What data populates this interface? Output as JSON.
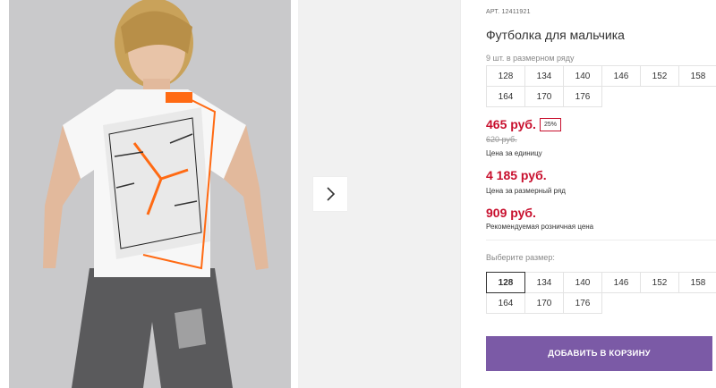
{
  "product": {
    "sku_prefix": "АРТ.",
    "sku": "12411921",
    "title": "Футболка для мальчика",
    "size_run_label": "9 шт. в размерном ряду",
    "size_run": [
      "128",
      "134",
      "140",
      "146",
      "152",
      "158",
      "164",
      "170",
      "176"
    ]
  },
  "pricing": {
    "unit_price": "465 руб.",
    "discount_badge": "25%",
    "old_price": "620 руб.",
    "unit_caption": "Цена за единицу",
    "run_price": "4 185 руб.",
    "run_caption": "Цена за размерный ряд",
    "retail_price": "909 руб.",
    "retail_caption": "Рекомендуемая розничная цена"
  },
  "size_select": {
    "label": "Выберите размер:",
    "options": [
      "128",
      "134",
      "140",
      "146",
      "152",
      "158",
      "164",
      "170",
      "176"
    ],
    "selected": "128"
  },
  "actions": {
    "add_to_cart": "ДОБАВИТЬ В КОРЗИНУ"
  },
  "icons": {
    "gallery_next": "chevron-right-icon"
  },
  "colors": {
    "price_red": "#c8102e",
    "cart_button": "#7b5aa6",
    "photo_bg": "#cfcfcf"
  }
}
